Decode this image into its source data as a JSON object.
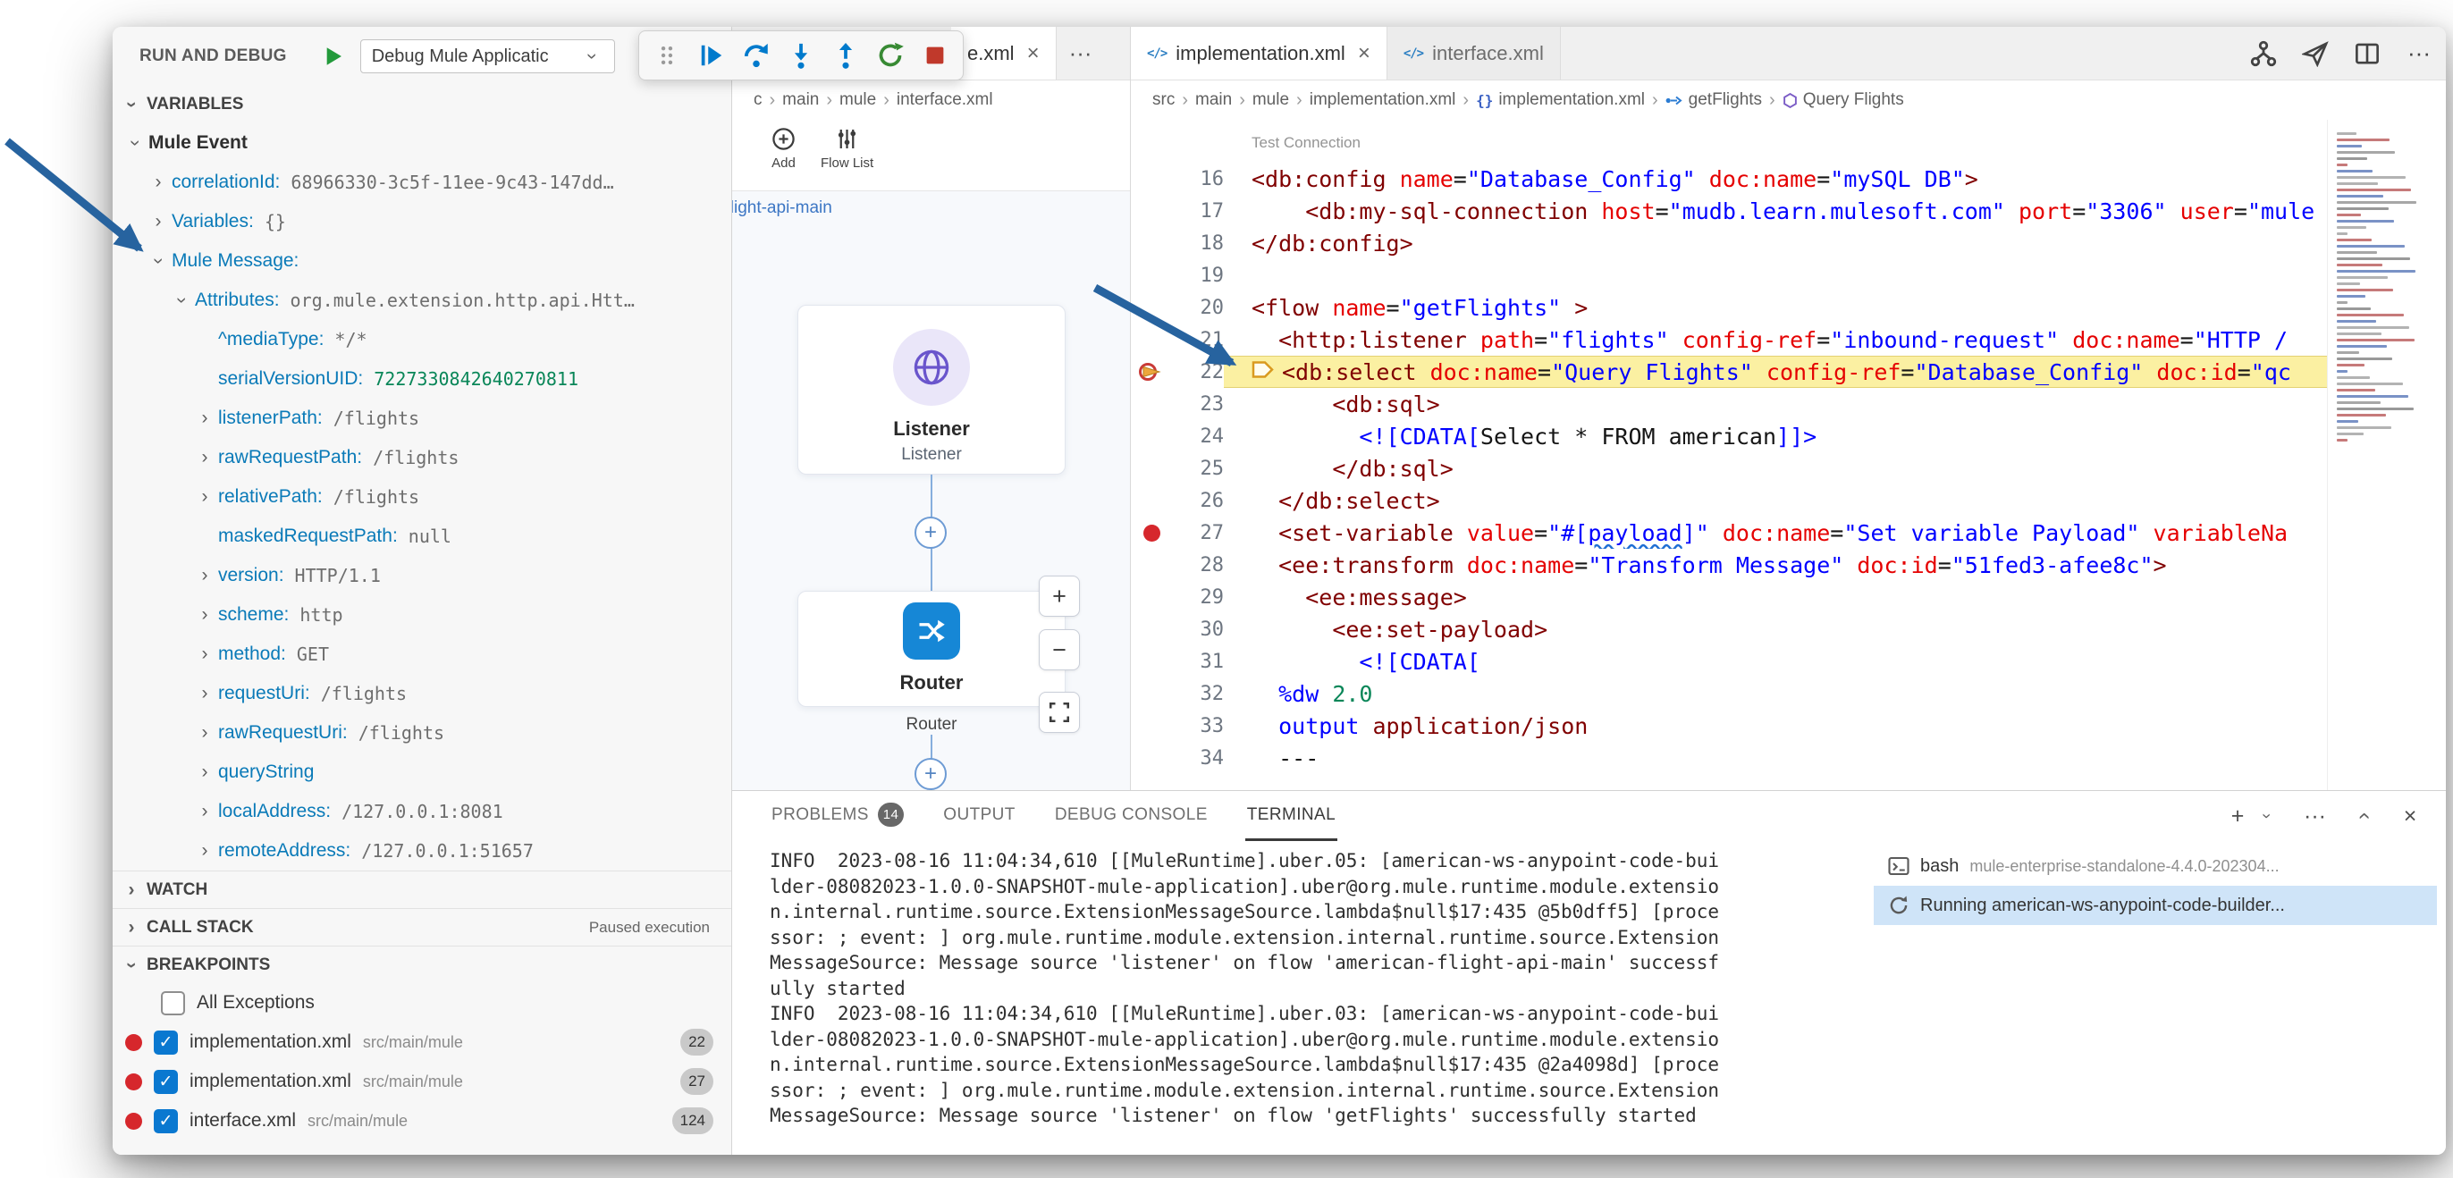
{
  "colors": {
    "accent_blue": "#007acc",
    "debug_green": "#388a34",
    "debug_red": "#a1260d",
    "breakpoint_red": "#d6272c",
    "current_line_yellow": "#fbf0a2",
    "arrow_blue": "#27639f"
  },
  "sidebar": {
    "title": "RUN AND DEBUG",
    "launch_dropdown": "Debug Mule Applicatic",
    "sections": {
      "variables": "VARIABLES",
      "watch": "WATCH",
      "call_stack": "CALL STACK",
      "call_stack_note": "Paused execution",
      "breakpoints": "BREAKPOINTS"
    },
    "variables_tree": [
      {
        "level": 0,
        "chevron": "down",
        "name": "Mule Event",
        "bold": true
      },
      {
        "level": 1,
        "chevron": "right",
        "name": "correlationId:",
        "value": "68966330-3c5f-11ee-9c43-147dd…"
      },
      {
        "level": 1,
        "chevron": "right",
        "name": "Variables:",
        "value": "{}"
      },
      {
        "level": 1,
        "chevron": "down",
        "name": "Mule Message:"
      },
      {
        "level": 2,
        "chevron": "down",
        "name": "Attributes:",
        "value": "org.mule.extension.http.api.Htt…"
      },
      {
        "level": 3,
        "chevron": "none",
        "name": "^mediaType:",
        "value": "*/*"
      },
      {
        "level": 3,
        "chevron": "none",
        "name": "serialVersionUID:",
        "value": "7227330842640270811",
        "value_color": "number"
      },
      {
        "level": 3,
        "chevron": "right",
        "name": "listenerPath:",
        "value": "/flights"
      },
      {
        "level": 3,
        "chevron": "right",
        "name": "rawRequestPath:",
        "value": "/flights"
      },
      {
        "level": 3,
        "chevron": "right",
        "name": "relativePath:",
        "value": "/flights"
      },
      {
        "level": 3,
        "chevron": "none",
        "name": "maskedRequestPath:",
        "value": "null"
      },
      {
        "level": 3,
        "chevron": "right",
        "name": "version:",
        "value": "HTTP/1.1"
      },
      {
        "level": 3,
        "chevron": "right",
        "name": "scheme:",
        "value": "http"
      },
      {
        "level": 3,
        "chevron": "right",
        "name": "method:",
        "value": "GET"
      },
      {
        "level": 3,
        "chevron": "right",
        "name": "requestUri:",
        "value": "/flights"
      },
      {
        "level": 3,
        "chevron": "right",
        "name": "rawRequestUri:",
        "value": "/flights"
      },
      {
        "level": 3,
        "chevron": "right",
        "name": "queryString"
      },
      {
        "level": 3,
        "chevron": "right",
        "name": "localAddress:",
        "value": "/127.0.0.1:8081"
      },
      {
        "level": 3,
        "chevron": "right",
        "name": "remoteAddress:",
        "value": "/127.0.0.1:51657"
      }
    ],
    "breakpoints": {
      "all_exceptions": "All Exceptions",
      "items": [
        {
          "file": "implementation.xml",
          "path": "src/main/mule",
          "line": "22"
        },
        {
          "file": "implementation.xml",
          "path": "src/main/mule",
          "line": "27"
        },
        {
          "file": "interface.xml",
          "path": "src/main/mule",
          "line": "124"
        }
      ]
    }
  },
  "debug_toolbar": {
    "buttons": [
      "drag-handle",
      "continue",
      "step-over",
      "step-into",
      "step-out",
      "restart",
      "stop"
    ]
  },
  "canvas": {
    "tab_label": "e.xml",
    "tab_close": "×",
    "overflow_label": "···",
    "breadcrumb": [
      "c",
      "main",
      "mule",
      "interface.xml"
    ],
    "toolbar": [
      {
        "label": "Add",
        "icon": "add-circle"
      },
      {
        "label": "Flow List",
        "icon": "flow-list"
      }
    ],
    "flow_title": "american-flight-api-main",
    "nodes": [
      {
        "type": "Listener",
        "caption": "Listener",
        "icon": "globe"
      },
      {
        "type": "Router",
        "caption": "Router",
        "icon": "router"
      }
    ],
    "zoom_controls": {
      "zoom_in": "+",
      "zoom_out": "−",
      "fit": "fit-view"
    }
  },
  "editor": {
    "tabs": [
      {
        "label": "implementation.xml",
        "active": true,
        "close": "×"
      },
      {
        "label": "interface.xml",
        "active": false
      }
    ],
    "actions": [
      "flow-graph",
      "deploy",
      "split-editor",
      "more"
    ],
    "breadcrumb": [
      {
        "label": "src"
      },
      {
        "label": "main"
      },
      {
        "label": "mule"
      },
      {
        "label": "implementation.xml"
      },
      {
        "label": "implementation.xml",
        "icon": "braces"
      },
      {
        "label": "getFlights",
        "icon": "flow"
      },
      {
        "label": "Query Flights",
        "icon": "module"
      }
    ],
    "codelens": "Test Connection",
    "code": [
      {
        "n": 16,
        "segs": [
          [
            "t",
            "<db:config"
          ],
          [
            "p",
            " "
          ],
          [
            "a",
            "name"
          ],
          [
            "p",
            "="
          ],
          [
            "s",
            "\"Database_Config\""
          ],
          [
            "p",
            " "
          ],
          [
            "a",
            "doc:name"
          ],
          [
            "p",
            "="
          ],
          [
            "s",
            "\"mySQL DB\""
          ],
          [
            "t",
            ">"
          ]
        ]
      },
      {
        "n": 17,
        "segs": [
          [
            "p",
            "    "
          ],
          [
            "t",
            "<db:my-sql-connection"
          ],
          [
            "p",
            " "
          ],
          [
            "a",
            "host"
          ],
          [
            "p",
            "="
          ],
          [
            "s",
            "\"mudb.learn.mulesoft.com\""
          ],
          [
            "p",
            " "
          ],
          [
            "a",
            "port"
          ],
          [
            "p",
            "="
          ],
          [
            "s",
            "\"3306\""
          ],
          [
            "p",
            " "
          ],
          [
            "a",
            "user"
          ],
          [
            "p",
            "="
          ],
          [
            "s",
            "\"mule"
          ]
        ]
      },
      {
        "n": 18,
        "segs": [
          [
            "t",
            "</db:config>"
          ]
        ]
      },
      {
        "n": 19,
        "segs": []
      },
      {
        "n": 20,
        "segs": [
          [
            "t",
            "<flow"
          ],
          [
            "p",
            " "
          ],
          [
            "a",
            "name"
          ],
          [
            "p",
            "="
          ],
          [
            "s",
            "\"getFlights\""
          ],
          [
            "p",
            " "
          ],
          [
            "t",
            ">"
          ]
        ]
      },
      {
        "n": 21,
        "segs": [
          [
            "p",
            "  "
          ],
          [
            "t",
            "<http:listener"
          ],
          [
            "p",
            " "
          ],
          [
            "a",
            "path"
          ],
          [
            "p",
            "="
          ],
          [
            "s",
            "\"flights\""
          ],
          [
            "p",
            " "
          ],
          [
            "a",
            "config-ref"
          ],
          [
            "p",
            "="
          ],
          [
            "s",
            "\"inbound-request\""
          ],
          [
            "p",
            " "
          ],
          [
            "a",
            "doc:name"
          ],
          [
            "p",
            "="
          ],
          [
            "s",
            "\"HTTP /"
          ]
        ]
      },
      {
        "n": 22,
        "current": true,
        "bp": "paused",
        "segs": [
          [
            "t",
            "<db:select"
          ],
          [
            "p",
            " "
          ],
          [
            "a",
            "doc:name"
          ],
          [
            "p",
            "="
          ],
          [
            "s",
            "\"Query Flights\""
          ],
          [
            "p",
            " "
          ],
          [
            "a",
            "config-ref"
          ],
          [
            "p",
            "="
          ],
          [
            "s",
            "\"Database_Config\""
          ],
          [
            "p",
            " "
          ],
          [
            "a",
            "doc:id"
          ],
          [
            "p",
            "="
          ],
          [
            "s",
            "\"qc"
          ]
        ]
      },
      {
        "n": 23,
        "segs": [
          [
            "p",
            "      "
          ],
          [
            "t",
            "<db:sql>"
          ]
        ]
      },
      {
        "n": 24,
        "segs": [
          [
            "p",
            "        "
          ],
          [
            "k",
            "<![CDATA["
          ],
          [
            "p",
            "Select * FROM american"
          ],
          [
            "k",
            "]]>"
          ]
        ]
      },
      {
        "n": 25,
        "segs": [
          [
            "p",
            "      "
          ],
          [
            "t",
            "</db:sql>"
          ]
        ]
      },
      {
        "n": 26,
        "segs": [
          [
            "p",
            "  "
          ],
          [
            "t",
            "</db:select>"
          ]
        ]
      },
      {
        "n": 27,
        "bp": "dot",
        "segs": [
          [
            "p",
            "  "
          ],
          [
            "t",
            "<set-variable"
          ],
          [
            "p",
            " "
          ],
          [
            "a",
            "value"
          ],
          [
            "p",
            "="
          ],
          [
            "s",
            "\"#["
          ],
          [
            "u",
            "payload"
          ],
          [
            "s",
            "]\""
          ],
          [
            "p",
            " "
          ],
          [
            "a",
            "doc:name"
          ],
          [
            "p",
            "="
          ],
          [
            "s",
            "\"Set variable Payload\""
          ],
          [
            "p",
            " "
          ],
          [
            "a",
            "variableNa"
          ]
        ]
      },
      {
        "n": 28,
        "segs": [
          [
            "p",
            "  "
          ],
          [
            "t",
            "<ee:transform"
          ],
          [
            "p",
            " "
          ],
          [
            "a",
            "doc:name"
          ],
          [
            "p",
            "="
          ],
          [
            "s",
            "\"Transform Message\""
          ],
          [
            "p",
            " "
          ],
          [
            "a",
            "doc:id"
          ],
          [
            "p",
            "="
          ],
          [
            "s",
            "\"51fed3-afee8c\""
          ],
          [
            "t",
            ">"
          ]
        ]
      },
      {
        "n": 29,
        "segs": [
          [
            "p",
            "    "
          ],
          [
            "t",
            "<ee:message>"
          ]
        ]
      },
      {
        "n": 30,
        "segs": [
          [
            "p",
            "      "
          ],
          [
            "t",
            "<ee:set-payload>"
          ]
        ]
      },
      {
        "n": 31,
        "segs": [
          [
            "p",
            "        "
          ],
          [
            "k",
            "<![CDATA["
          ]
        ]
      },
      {
        "n": 32,
        "segs": [
          [
            "p",
            "  "
          ],
          [
            "k",
            "%dw"
          ],
          [
            "p",
            " "
          ],
          [
            "n",
            "2.0"
          ]
        ]
      },
      {
        "n": 33,
        "segs": [
          [
            "p",
            "  "
          ],
          [
            "k",
            "output"
          ],
          [
            "p",
            " "
          ],
          [
            "m",
            "application/json"
          ]
        ]
      },
      {
        "n": 34,
        "segs": [
          [
            "p",
            "  ---"
          ]
        ]
      }
    ]
  },
  "panel": {
    "tabs": [
      {
        "label": "PROBLEMS",
        "badge": "14"
      },
      {
        "label": "OUTPUT"
      },
      {
        "label": "DEBUG CONSOLE"
      },
      {
        "label": "TERMINAL",
        "active": true
      }
    ],
    "icons": [
      "new-terminal",
      "terminal-dropdown",
      "more-actions",
      "maximize-panel",
      "close-panel"
    ],
    "terminal_lines": [
      "INFO  2023-08-16 11:04:34,610 [[MuleRuntime].uber.05: [american-ws-anypoint-code-bui",
      "lder-08082023-1.0.0-SNAPSHOT-mule-application].uber@org.mule.runtime.module.extensio",
      "n.internal.runtime.source.ExtensionMessageSource.lambda$null$17:435 @5b0dff5] [proce",
      "ssor: ; event: ] org.mule.runtime.module.extension.internal.runtime.source.Extension",
      "MessageSource: Message source 'listener' on flow 'american-flight-api-main' successf",
      "ully started",
      "INFO  2023-08-16 11:04:34,610 [[MuleRuntime].uber.03: [american-ws-anypoint-code-bui",
      "lder-08082023-1.0.0-SNAPSHOT-mule-application].uber@org.mule.runtime.module.extensio",
      "n.internal.runtime.source.ExtensionMessageSource.lambda$null$17:435 @2a4098d] [proce",
      "ssor: ; event: ] org.mule.runtime.module.extension.internal.runtime.source.Extension",
      "MessageSource: Message source 'listener' on flow 'getFlights' successfully started"
    ],
    "sessions": [
      {
        "name": "bash",
        "desc": "mule-enterprise-standalone-4.4.0-202304...",
        "icon": "terminal"
      },
      {
        "name": "Running american-ws-anypoint-code-builder...",
        "icon": "sync",
        "selected": true
      }
    ]
  }
}
